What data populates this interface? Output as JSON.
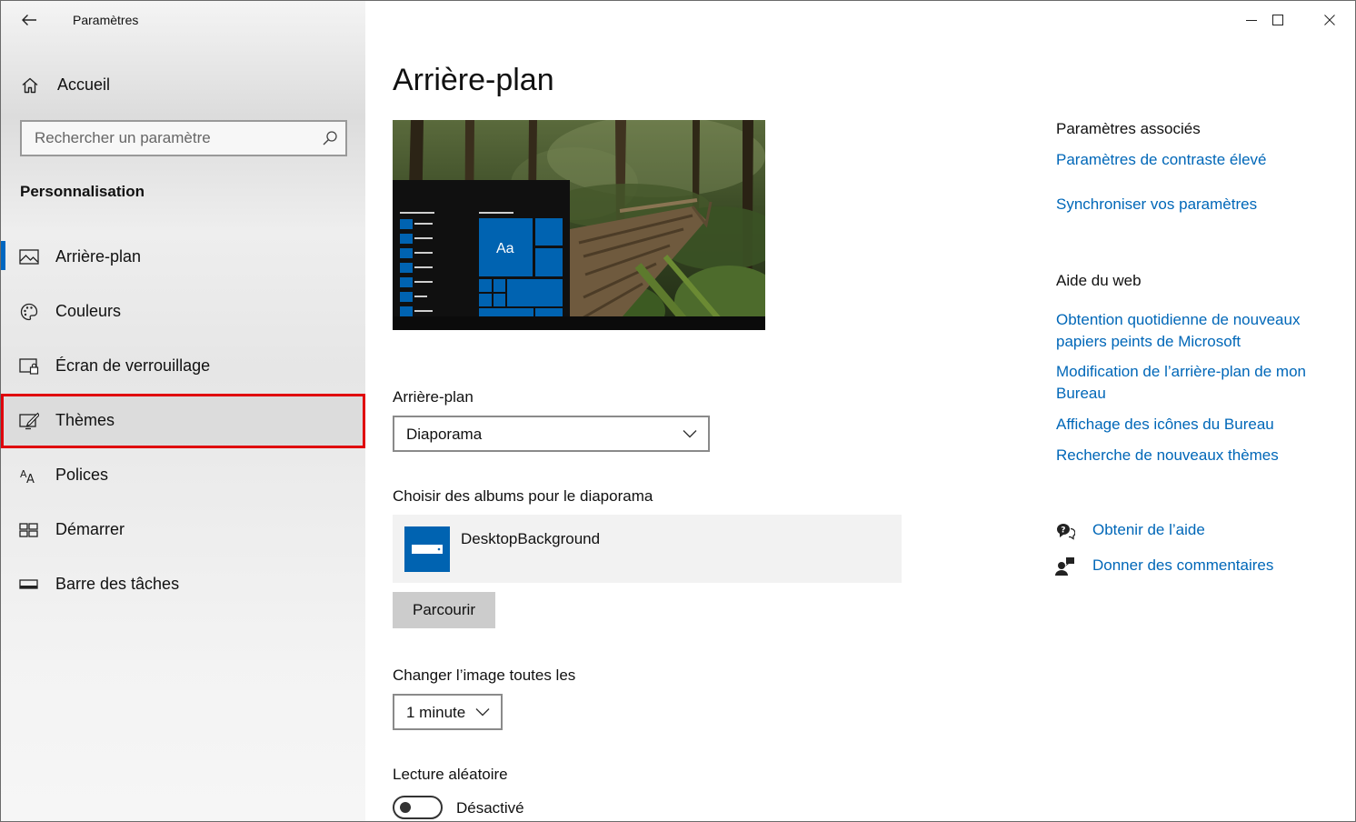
{
  "window": {
    "title": "Paramètres"
  },
  "sidebar": {
    "home_label": "Accueil",
    "search_placeholder": "Rechercher un paramètre",
    "section_title": "Personnalisation",
    "items": [
      {
        "label": "Arrière-plan",
        "icon": "picture-icon",
        "selected": true
      },
      {
        "label": "Couleurs",
        "icon": "palette-icon"
      },
      {
        "label": "Écran de verrouillage",
        "icon": "lock-screen-icon"
      },
      {
        "label": "Thèmes",
        "icon": "themes-icon",
        "highlighted": true
      },
      {
        "label": "Polices",
        "icon": "fonts-icon"
      },
      {
        "label": "Démarrer",
        "icon": "start-icon"
      },
      {
        "label": "Barre des tâches",
        "icon": "taskbar-icon"
      }
    ]
  },
  "main": {
    "title": "Arrière-plan",
    "preview_tile_text": "Aa",
    "background_label": "Arrière-plan",
    "background_value": "Diaporama",
    "albums_label": "Choisir des albums pour le diaporama",
    "album_name": "DesktopBackground",
    "browse_label": "Parcourir",
    "interval_label": "Changer l’image toutes les",
    "interval_value": "1 minute",
    "shuffle_label": "Lecture aléatoire",
    "shuffle_state": "Désactivé"
  },
  "related": {
    "title": "Paramètres associés",
    "links": [
      "Paramètres de contraste élevé",
      "Synchroniser vos paramètres"
    ]
  },
  "web_help": {
    "title": "Aide du web",
    "links": [
      "Obtention quotidienne de nouveaux papiers peints de Microsoft",
      "Modification de l’arrière-plan de mon Bureau",
      "Affichage des icônes du Bureau",
      "Recherche de nouveaux thèmes"
    ]
  },
  "help": {
    "get_help": "Obtenir de l’aide",
    "feedback": "Donner des commentaires"
  },
  "colors": {
    "accent": "#0067c0",
    "link": "#0067b8",
    "highlight_border": "#e0000b",
    "tile_blue": "#0063b1"
  }
}
